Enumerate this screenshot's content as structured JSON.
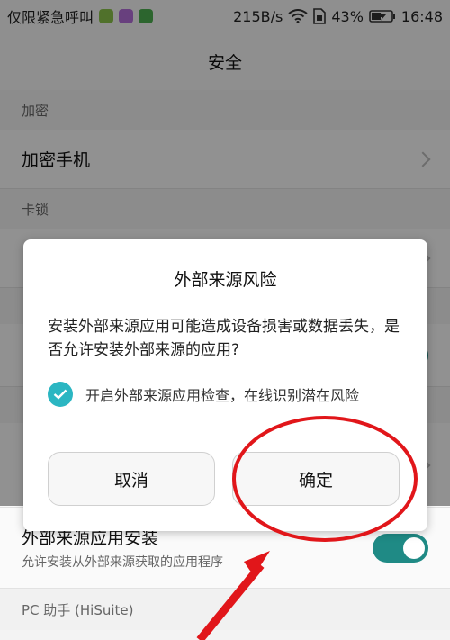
{
  "status_bar": {
    "carrier": "仅限紧急呼叫",
    "speed": "215B/s",
    "battery": "43%",
    "time": "16:48"
  },
  "header": {
    "title": "安全"
  },
  "settings": {
    "sections": [
      {
        "header": "加密",
        "rows": [
          {
            "title": "加密手机"
          }
        ]
      },
      {
        "header": "卡锁"
      }
    ],
    "bottom_rows": {
      "ext_install_title": "外部来源应用安装",
      "ext_install_sub": "允许安装从外部来源获取的应用程序",
      "pc_section": "PC 助手 (HiSuite)"
    }
  },
  "dialog": {
    "title": "外部来源风险",
    "message": "安装外部来源应用可能造成设备损害或数据丢失，是否允许安装外部来源的应用?",
    "checkbox_label": "开启外部来源应用检查，在线识别潜在风险",
    "cancel_label": "取消",
    "confirm_label": "确定"
  },
  "colors": {
    "accent": "#2bb6c2",
    "toggle_on": "#1f8a85",
    "annotation": "#e1161a"
  }
}
